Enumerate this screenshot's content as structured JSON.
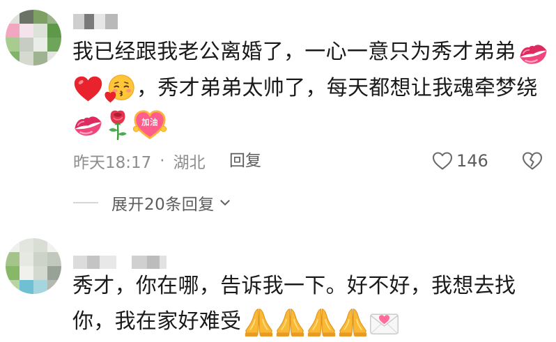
{
  "theme": {
    "text_color": "#1a1a1a",
    "meta_color": "#8d8d8d",
    "action_color": "#5c5c5c",
    "divider_color": "#d6d6d6"
  },
  "stickers": {
    "jiayou_heart_text": "加油"
  },
  "comments": [
    {
      "lines": [
        {
          "text": "我已经跟我老公离婚了，一心一意只为秀才弟弟",
          "emojis_after": [
            "kiss-mark"
          ]
        },
        {
          "emojis_before": [
            "red-heart",
            "face-blowing-kiss"
          ],
          "text": "，秀才弟弟太帅了，每天都想让我魂牵梦绕"
        },
        {
          "emojis": [
            "kiss-mark",
            "rose",
            "jiayou-heart"
          ]
        }
      ],
      "time": "昨天18:17",
      "separator": "·",
      "location": "湖北",
      "reply_label": "回复",
      "like_icon": "heart-outline-icon",
      "like_count": "146",
      "dislike_icon": "broken-heart-icon",
      "expand_replies_label": "展开20条回复",
      "expand_icon": "chevron-down-icon"
    },
    {
      "lines": [
        {
          "text": "秀才，你在哪，告诉我一下。好不好，我想去找"
        },
        {
          "text": "你，我在家好难受",
          "emojis_after": [
            "folded-hands",
            "folded-hands",
            "folded-hands",
            "folded-hands",
            "love-letter"
          ]
        }
      ]
    }
  ]
}
